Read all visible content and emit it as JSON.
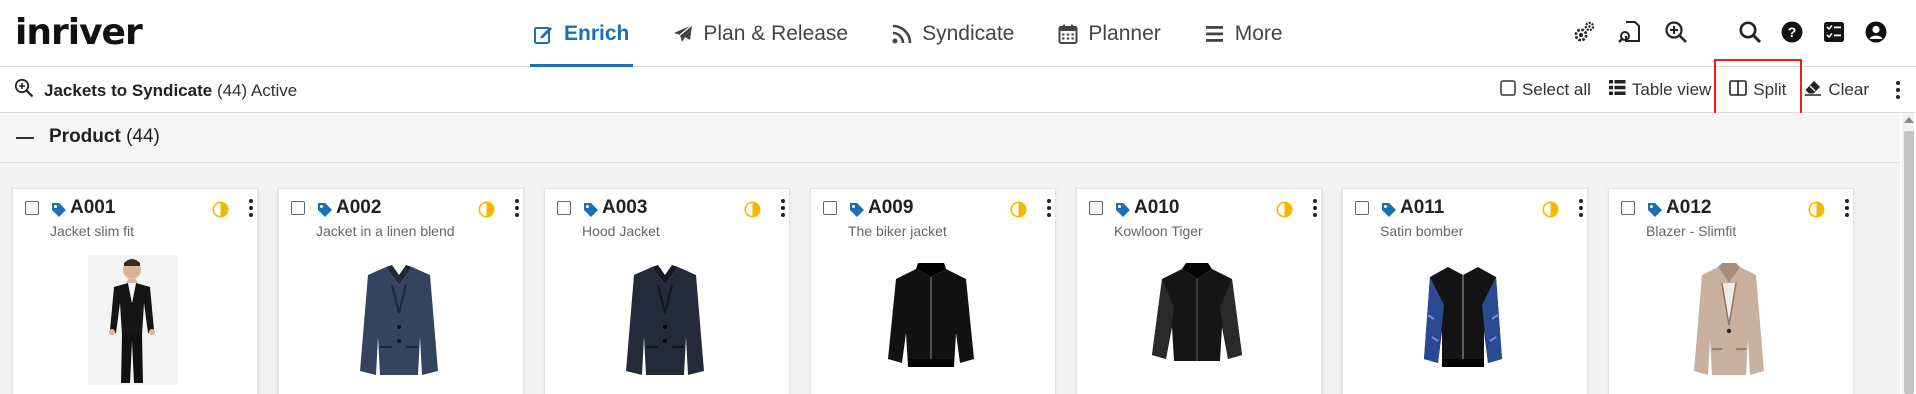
{
  "app": {
    "logo": "inriver"
  },
  "nav": {
    "items": [
      {
        "label": "Enrich",
        "icon": "edit-icon",
        "active": true
      },
      {
        "label": "Plan & Release",
        "icon": "paper-plane-icon",
        "active": false
      },
      {
        "label": "Syndicate",
        "icon": "rss-feed-icon",
        "active": false
      },
      {
        "label": "Planner",
        "icon": "calendar-icon",
        "active": false
      },
      {
        "label": "More",
        "icon": "hamburger-menu-icon",
        "active": false
      }
    ],
    "tools": [
      "settings-gears-icon",
      "document-search-icon",
      "zoom-in-icon",
      "search-icon",
      "help-icon",
      "task-checklist-icon",
      "user-account-icon"
    ]
  },
  "query": {
    "name": "Jackets to Syndicate",
    "count": "(44)",
    "status": "Active",
    "actions": {
      "select_all": "Select all",
      "table_view": "Table view",
      "split": "Split",
      "clear": "Clear"
    }
  },
  "group": {
    "title": "Product",
    "count": "(44)"
  },
  "colors": {
    "accent": "#1d6fb5",
    "status_half": "#f5b800",
    "highlight": "#e8201b",
    "tag": "#1d6fb5"
  },
  "cards": [
    {
      "id": "A001",
      "name": "Jacket slim fit",
      "image": "model-wearing-black-suit-jacket"
    },
    {
      "id": "A002",
      "name": "Jacket in a linen blend",
      "image": "navy-linen-blazer"
    },
    {
      "id": "A003",
      "name": "Hood Jacket",
      "image": "dark-navy-blazer"
    },
    {
      "id": "A009",
      "name": "The biker jacket",
      "image": "black-bomber-jacket"
    },
    {
      "id": "A010",
      "name": "Kowloon Tiger",
      "image": "black-varsity-jacket"
    },
    {
      "id": "A011",
      "name": "Satin bomber",
      "image": "black-blue-satin-bomber"
    },
    {
      "id": "A012",
      "name": "Blazer - Slimfit",
      "image": "beige-womens-blazer"
    }
  ]
}
